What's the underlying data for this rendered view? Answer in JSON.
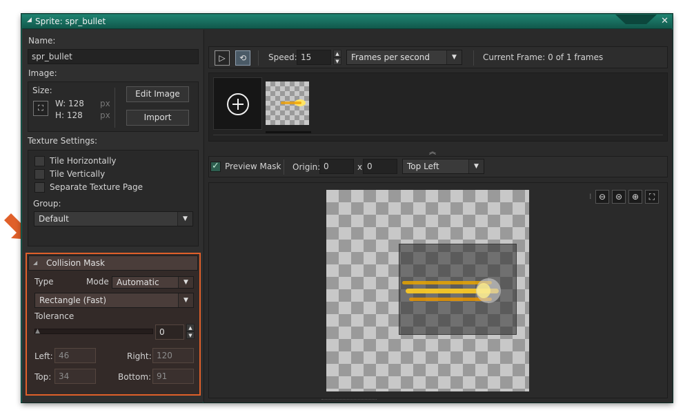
{
  "window": {
    "title": "Sprite: spr_bullet"
  },
  "left": {
    "name_label": "Name:",
    "name_value": "spr_bullet",
    "image_label": "Image:",
    "size_label": "Size:",
    "width_text": "W: 128",
    "height_text": "H: 128",
    "unit_w": "px",
    "unit_h": "px",
    "edit_image": "Edit Image",
    "import": "Import",
    "texture_settings_label": "Texture Settings:",
    "tile_horizontally": "Tile Horizontally",
    "tile_vertically": "Tile Vertically",
    "separate_texture_page": "Separate Texture Page",
    "group_label": "Group:",
    "group_value": "Default"
  },
  "collision": {
    "header": "Collision Mask",
    "type_label": "Type",
    "mode_label": "Mode",
    "mode_value": "Automatic",
    "shape_value": "Rectangle (Fast)",
    "tolerance_label": "Tolerance",
    "tolerance_value": "0",
    "tolerance_fraction": 0,
    "left_label": "Left:",
    "left_value": "46",
    "right_label": "Right:",
    "right_value": "120",
    "top_label": "Top:",
    "top_value": "34",
    "bottom_label": "Bottom:",
    "bottom_value": "91"
  },
  "toolbar": {
    "speed_label": "Speed:",
    "speed_value": "15",
    "speed_unit": "Frames per second",
    "current_frame": "Current Frame: 0 of 1 frames"
  },
  "mask": {
    "preview_mask_label": "Preview Mask",
    "preview_mask_checked": true,
    "origin_label": "Origin:",
    "origin_x": "0",
    "origin_sep": "x",
    "origin_y": "0",
    "origin_preset": "Top Left"
  },
  "icons": {
    "play": "play-icon",
    "loop": "loop-icon",
    "add_frame": "add-frame-icon",
    "resize": "resize-icon",
    "zoom_out": "zoom-out-icon",
    "zoom_reset": "zoom-reset-icon",
    "zoom_in": "zoom-in-icon",
    "fullscreen": "fullscreen-icon"
  },
  "colors": {
    "title_bar": "#1a7a68",
    "highlight": "#e0602a",
    "panel_bg": "#2b2b2b"
  }
}
